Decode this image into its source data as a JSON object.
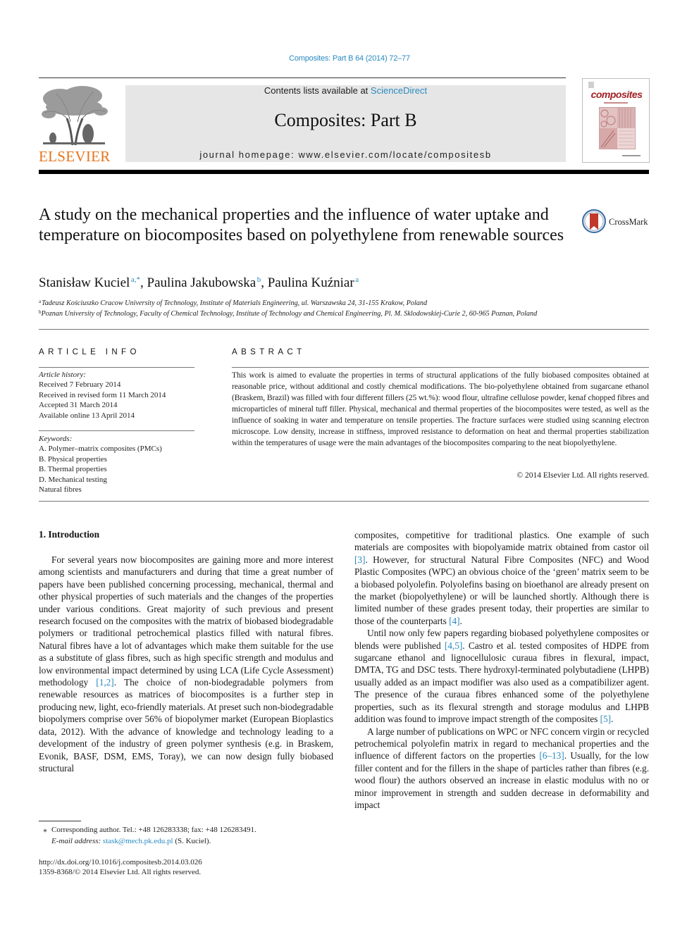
{
  "header": {
    "journal_ref": "Composites: Part B 64 (2014) 72–77",
    "contents_prefix": "Contents lists available at ",
    "contents_link": "ScienceDirect",
    "journal_name": "Composites: Part B",
    "homepage": "journal homepage: www.elsevier.com/locate/compositesb",
    "publisher_logo_text": "ELSEVIER",
    "cover_title": "composites",
    "colors": {
      "link": "#2a8ac0",
      "elsevier_orange": "#e8731a",
      "cover_red": "#a11f24",
      "header_box": "#e6e6e6"
    }
  },
  "article": {
    "title": "A study on the mechanical properties and the influence of water uptake and temperature on biocomposites based on polyethylene from renewable sources",
    "crossmark_label": "CrossMark",
    "authors": [
      {
        "name": "Stanisław Kuciel",
        "sup": "a,*",
        "sep": ", "
      },
      {
        "name": "Paulina Jakubowska",
        "sup": "b",
        "sep": ", "
      },
      {
        "name": "Paulina Kuźniar",
        "sup": "a",
        "sep": ""
      }
    ],
    "affiliations": [
      {
        "mark": "a",
        "text": "Tadeusz Kościuszko Cracow University of Technology, Institute of Materials Engineering, ul. Warszawska 24, 31-155 Krakow, Poland"
      },
      {
        "mark": "b",
        "text": "Poznan University of Technology, Faculty of Chemical Technology, Institute of Technology and Chemical Engineering, Pl. M. Sklodowskiej-Curie 2, 60-965 Poznan, Poland"
      }
    ]
  },
  "article_info": {
    "heading": "ARTICLE INFO",
    "history_label": "Article history:",
    "history": [
      "Received 7 February 2014",
      "Received in revised form 11 March 2014",
      "Accepted 31 March 2014",
      "Available online 13 April 2014"
    ],
    "keywords_label": "Keywords:",
    "keywords": [
      "A. Polymer–matrix composites (PMCs)",
      "B. Physical properties",
      "B. Thermal properties",
      "D. Mechanical testing",
      "Natural fibres"
    ]
  },
  "abstract": {
    "heading": "ABSTRACT",
    "text": "This work is aimed to evaluate the properties in terms of structural applications of the fully biobased composites obtained at reasonable price, without additional and costly chemical modifications. The bio-polyethylene obtained from sugarcane ethanol (Braskem, Brazil) was filled with four different fillers (25 wt.%): wood flour, ultrafine cellulose powder, kenaf chopped fibres and microparticles of mineral tuff filler. Physical, mechanical and thermal properties of the biocomposites were tested, as well as the influence of soaking in water and temperature on tensile properties. The fracture surfaces were studied using scanning electron microscope. Low density, increase in stiffness, improved resistance to deformation on heat and thermal properties stabilization within the temperatures of usage were the main advantages of the biocomposites comparing to the neat biopolyethylene.",
    "copyright": "© 2014 Elsevier Ltd. All rights reserved."
  },
  "body": {
    "section_heading": "1. Introduction",
    "left": {
      "p1_a": "For several years now biocomposites are gaining more and more interest among scientists and manufacturers and during that time a great number of papers have been published concerning processing, mechanical, thermal and other physical properties of such materials and the changes of the properties under various conditions. Great majority of such previous and present research focused on the composites with the matrix of biobased biodegradable polymers or traditional petrochemical plastics filled with natural fibres. Natural fibres have a lot of advantages which make them suitable for the use as a substitute of glass fibres, such as high specific strength and modulus and low environmental impact determined by using LCA (Life Cycle Assessment) methodology ",
      "ref_1": "[1,2]",
      "p1_b": ". The choice of non-biodegradable polymers from renewable resources as matrices of biocomposites is a further step in producing new, light, eco-friendly materials. At preset such non-biodegradable biopolymers comprise over 56% of biopolymer market (European Bioplastics data, 2012). With the advance of knowledge and technology leading to a development of the industry of green polymer synthesis (e.g. in Braskem, Evonik, BASF, DSM, EMS, Toray), we can now design fully biobased structural"
    },
    "right": {
      "p1_a": "composites, competitive for traditional plastics. One example of such materials are composites with biopolyamide matrix obtained from castor oil ",
      "ref_3": "[3]",
      "p1_b": ". However, for structural Natural Fibre Composites (NFC) and Wood Plastic Composites (WPC) an obvious choice of the ‘green’ matrix seem to be a biobased polyolefin. Polyolefins basing on bioethanol are already present on the market (biopolyethylene) or will be launched shortly. Although there is limited number of these grades present today, their properties are similar to those of the counterparts ",
      "ref_4": "[4]",
      "p1_c": ".",
      "p2_a": "Until now only few papers regarding biobased polyethylene composites or blends were published ",
      "ref_45": "[4,5]",
      "p2_b": ". Castro et al. tested composites of HDPE from sugarcane ethanol and lignocellulosic curaua fibres in flexural, impact, DMTA, TG and DSC tests. There hydroxyl-terminated polybutadiene (LHPB) usually added as an impact modifier was also used as a compatibilizer agent. The presence of the curaua fibres enhanced some of the polyethylene properties, such as its flexural strength and storage modulus and LHPB addition was found to improve impact strength of the composites ",
      "ref_5": "[5]",
      "p2_c": ".",
      "p3_a": "A large number of publications on WPC or NFC concern virgin or recycled petrochemical polyolefin matrix in regard to mechanical properties and the influence of different factors on the properties ",
      "ref_613": "[6–13]",
      "p3_b": ". Usually, for the low filler content and for the fillers in the shape of particles rather than fibres (e.g. wood flour) the authors observed an increase in elastic modulus with no or minor improvement in strength and sudden decrease in deformability and impact"
    }
  },
  "footnotes": {
    "star": "⁎",
    "corresponding": "Corresponding author. Tel.: +48 126283338; fax: +48 126283491.",
    "email_label": "E-mail address:",
    "email": "stask@mech.pk.edu.pl",
    "email_suffix": " (S. Kuciel).",
    "doi": "http://dx.doi.org/10.1016/j.compositesb.2014.03.026",
    "issn": "1359-8368/© 2014 Elsevier Ltd. All rights reserved."
  }
}
